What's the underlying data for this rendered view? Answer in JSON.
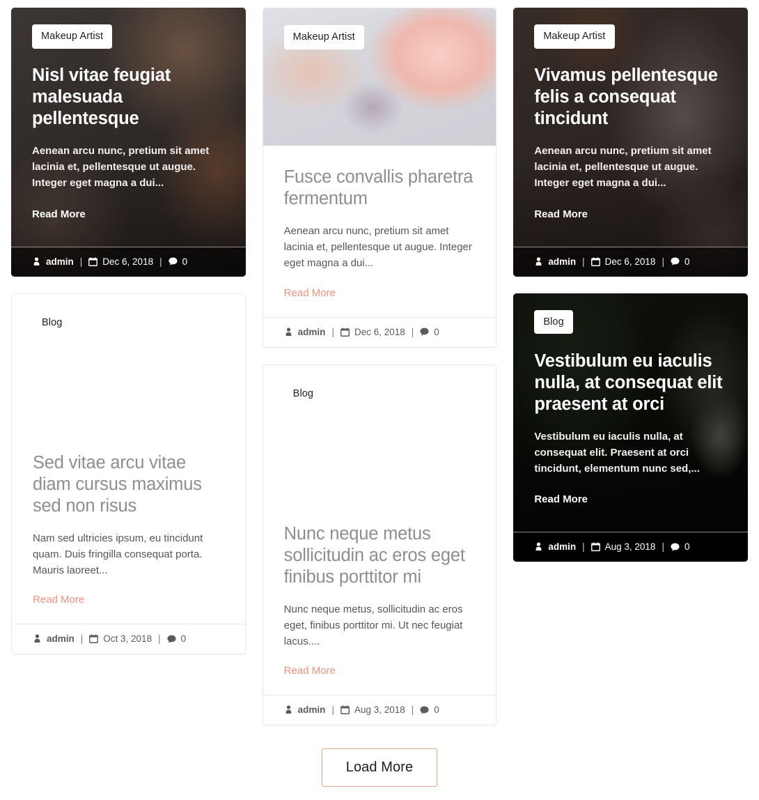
{
  "columns": [
    {
      "cards": [
        {
          "style": "dark",
          "photo": "ph-makeup1",
          "badge": "Makeup Artist",
          "title": "Nisl vitae feugiat malesuada pellentesque",
          "excerpt": "Aenean arcu nunc, pretium sit amet lacinia et, pellentesque ut augue. Integer eget magna a dui...",
          "read_more": "Read More",
          "meta": {
            "author": "admin",
            "date": "Dec 6, 2018",
            "comments": "0"
          }
        },
        {
          "style": "light",
          "photo": "ph-bride",
          "badge": "Blog",
          "title": "Sed vitae arcu vitae diam cursus maximus sed non risus",
          "excerpt": "Nam sed ultricies ipsum, eu tincidunt quam. Duis fringilla consequat porta. Mauris laoreet...",
          "read_more": "Read More",
          "meta": {
            "author": "admin",
            "date": "Oct 3, 2018",
            "comments": "0"
          }
        }
      ]
    },
    {
      "cards": [
        {
          "style": "light",
          "photo": "ph-lips",
          "badge": "Makeup Artist",
          "title": "Fusce convallis pharetra fermentum",
          "excerpt": "Aenean arcu nunc, pretium sit amet lacinia et, pellentesque ut augue. Integer eget magna a dui...",
          "read_more": "Read More",
          "meta": {
            "author": "admin",
            "date": "Dec 6, 2018",
            "comments": "0"
          }
        },
        {
          "style": "light",
          "photo": "ph-bride",
          "badge": "Blog",
          "title": "Nunc neque metus sollicitudin ac eros eget finibus porttitor mi",
          "excerpt": "Nunc neque metus, sollicitudin ac eros eget, finibus porttitor mi. Ut nec feugiat lacus....",
          "read_more": "Read More",
          "meta": {
            "author": "admin",
            "date": "Aug 3, 2018",
            "comments": "0"
          }
        }
      ]
    },
    {
      "cards": [
        {
          "style": "dark",
          "photo": "ph-makeup3",
          "badge": "Makeup Artist",
          "title": "Vivamus pellentesque felis a consequat tincidunt",
          "excerpt": "Aenean arcu nunc, pretium sit amet lacinia et, pellentesque ut augue. Integer eget magna a dui...",
          "read_more": "Read More",
          "meta": {
            "author": "admin",
            "date": "Dec 6, 2018",
            "comments": "0"
          }
        },
        {
          "style": "dark-black",
          "photo": "ph-palm",
          "badge": "Blog",
          "title": "Vestibulum eu iaculis nulla, at consequat elit praesent at orci",
          "excerpt": "Vestibulum eu iaculis nulla, at consequat elit. Praesent at orci tincidunt, elementum nunc sed,...",
          "read_more": "Read More",
          "meta": {
            "author": "admin",
            "date": "Aug 3, 2018",
            "comments": "0"
          }
        }
      ]
    }
  ],
  "footer": {
    "load_more_label": "Load More"
  },
  "colors": {
    "accent": "#e79480",
    "button_border": "#e0a58f",
    "light_title": "#8e8e8e",
    "light_excerpt": "#575757",
    "meta_text": "#5b5b5b"
  },
  "icons": {
    "author": "user-icon",
    "date": "calendar-icon",
    "comments": "comment-icon"
  },
  "separator": "|"
}
